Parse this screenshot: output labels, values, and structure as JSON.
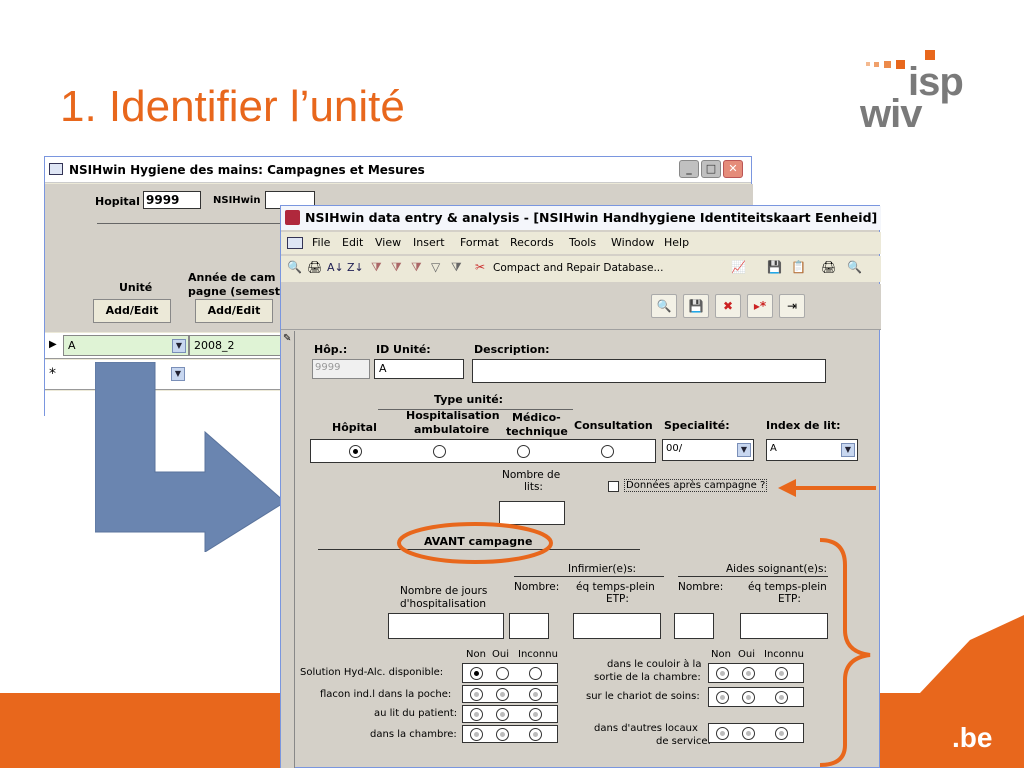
{
  "slide": {
    "title": "1. Identifier l’unité",
    "logo": {
      "line1": "isp",
      "line2": "wiv"
    },
    "footer_domain": ".be",
    "colors": {
      "accent": "#e8671c",
      "arrow": "#6a85b0",
      "access_bg": "#d4d0c8"
    }
  },
  "back_window": {
    "title": "NSIHwin Hygiene des mains: Campagnes et Mesures",
    "hopital_label": "Hopital",
    "hopital_value": "9999",
    "nsihwin_label": "NSIHwin",
    "col_unite": "Unité",
    "col_annee_line1": "Année de cam",
    "col_annee_line2": "pagne (semest",
    "add_edit_1": "Add/Edit",
    "add_edit_2": "Add/Edit",
    "row1_unite": "A",
    "row1_annee": "2008_2",
    "new_row_marker": "*",
    "current_row_marker": "▶"
  },
  "front_window": {
    "title": "NSIHwin data entry & analysis - [NSIHwin Handhygiene Identiteitskaart Eenheid]",
    "menu": [
      "File",
      "Edit",
      "View",
      "Insert",
      "Format",
      "Records",
      "Tools",
      "Window",
      "Help"
    ],
    "toolbar_compact": "Compact and Repair Database...",
    "form": {
      "hop_label": "Hôp.:",
      "hop_value": "9999",
      "id_unite_label": "ID Unité:",
      "id_unite_value": "A",
      "description_label": "Description:",
      "type_unite_label": "Type unité:",
      "type_hopital": "Hôpital",
      "type_hosp_amb_1": "Hospitalisation",
      "type_hosp_amb_2": "ambulatoire",
      "type_medico_1": "Médico-",
      "type_medico_2": "technique",
      "type_consultation": "Consultation",
      "specialite_label": "Specialité:",
      "specialite_value": "00/",
      "index_lit_label": "Index de lit:",
      "index_lit_value": "A",
      "nombre_lits_1": "Nombre de",
      "nombre_lits_2": "lits:",
      "donnees_apres": "Données après campagne ?",
      "avant_campagne": "AVANT campagne",
      "infirmiers_label": "Infirmier(e)s:",
      "aides_label": "Aides soignant(e)s:",
      "nombre_jours_1": "Nombre de jours",
      "nombre_jours_2": "d'hospitalisation",
      "nombre_label_1": "Nombre:",
      "eq_temps_1": "éq temps-plein",
      "etp_1": "ETP:",
      "nombre_label_2": "Nombre:",
      "eq_temps_2": "éq temps-plein",
      "etp_2": "ETP:",
      "col_non": "Non",
      "col_oui": "Oui",
      "col_inconnu": "Inconnu",
      "left_rows": [
        "Solution Hyd-Alc. disponible:",
        "flacon ind.l dans la poche:",
        "au lit du patient:",
        "dans la chambre:"
      ],
      "right_row1_a": "dans le couloir à la",
      "right_row1_b": "sortie de la chambre:",
      "right_row2": "sur le chariot de soins:",
      "right_row3_a": "dans d'autres locaux",
      "right_row3_b": "de service:"
    }
  }
}
